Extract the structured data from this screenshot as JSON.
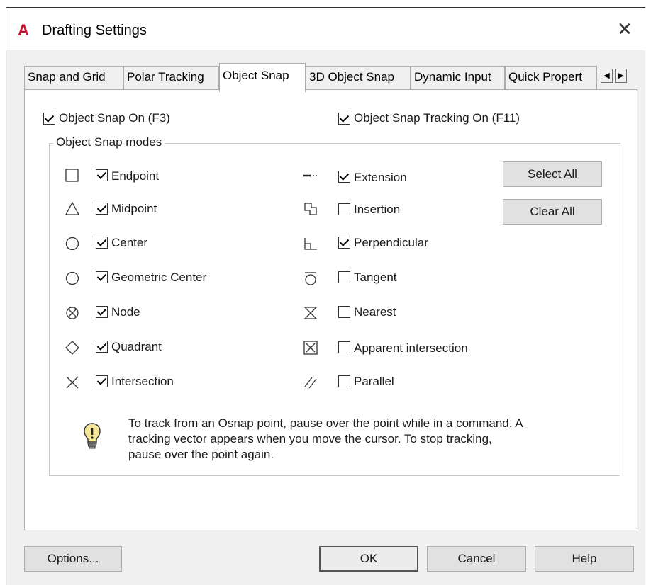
{
  "window": {
    "app_logo": "A",
    "title": "Drafting Settings",
    "close_glyph": "✕"
  },
  "tabs": [
    {
      "label": "Snap and Grid",
      "active": false
    },
    {
      "label": "Polar Tracking",
      "active": false
    },
    {
      "label": "Object Snap",
      "active": true
    },
    {
      "label": "3D Object Snap",
      "active": false
    },
    {
      "label": "Dynamic Input",
      "active": false
    },
    {
      "label": "Quick Propert",
      "active": false
    }
  ],
  "tab_scroll": {
    "left": "◀",
    "right": "▶"
  },
  "toggles": {
    "osnap_on": {
      "label": "Object Snap On (F3)",
      "checked": true
    },
    "tracking_on": {
      "label": "Object Snap Tracking On (F11)",
      "checked": true
    }
  },
  "modes": {
    "title": "Object Snap modes",
    "left": [
      {
        "label": "Endpoint",
        "checked": true,
        "icon": "endpoint-icon"
      },
      {
        "label": "Midpoint",
        "checked": true,
        "icon": "midpoint-icon"
      },
      {
        "label": "Center",
        "checked": true,
        "icon": "center-icon"
      },
      {
        "label": "Geometric Center",
        "checked": true,
        "icon": "geometric-center-icon"
      },
      {
        "label": "Node",
        "checked": true,
        "icon": "node-icon"
      },
      {
        "label": "Quadrant",
        "checked": true,
        "icon": "quadrant-icon"
      },
      {
        "label": "Intersection",
        "checked": true,
        "icon": "intersection-icon"
      }
    ],
    "right": [
      {
        "label": "Extension",
        "checked": true,
        "icon": "extension-icon"
      },
      {
        "label": "Insertion",
        "checked": false,
        "icon": "insertion-icon"
      },
      {
        "label": "Perpendicular",
        "checked": true,
        "icon": "perpendicular-icon"
      },
      {
        "label": "Tangent",
        "checked": false,
        "icon": "tangent-icon"
      },
      {
        "label": "Nearest",
        "checked": false,
        "icon": "nearest-icon"
      },
      {
        "label": "Apparent intersection",
        "checked": false,
        "icon": "apparent-intersection-icon"
      },
      {
        "label": "Parallel",
        "checked": false,
        "icon": "parallel-icon"
      }
    ],
    "select_all": "Select All",
    "clear_all": "Clear All"
  },
  "info": {
    "line1": "To track from an Osnap point, pause over the point while in a command.  A",
    "line2": "tracking vector appears when you move the cursor.  To stop tracking,",
    "line3": "pause over the point again."
  },
  "footer": {
    "options": "Options...",
    "ok": "OK",
    "cancel": "Cancel",
    "help": "Help"
  },
  "colors": {
    "logo": "#c8102e",
    "dialog_bg": "#f0f0f0",
    "panel_bg": "#ffffff"
  }
}
